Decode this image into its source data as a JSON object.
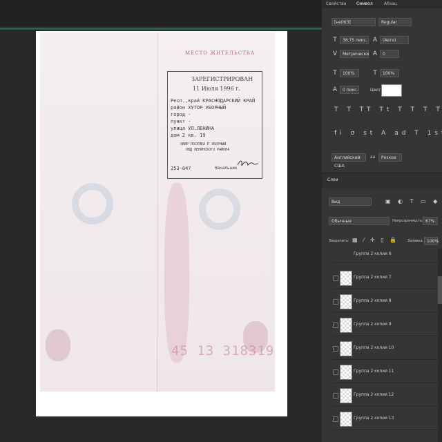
{
  "panel_tabs": [
    "Свойства",
    "Символ",
    "Абзац"
  ],
  "character": {
    "font_family": "[не063]",
    "font_style": "Regular",
    "size": "38,75 пикс.",
    "leading": "(Авто)",
    "kerning": "Метрически",
    "tracking": "0",
    "vert_scale": "100%",
    "horiz_scale": "100%",
    "baseline": "0 пикс.",
    "color_label": "Цвет:",
    "color_value": "#ffffff",
    "language": "Английский: США",
    "antialias": "Резкое",
    "aa_label": "аа"
  },
  "layers": {
    "tab_label": "Слои",
    "filter_kind": "Вид",
    "blend_mode": "Обычные",
    "opacity_label": "Непрозрачность:",
    "opacity_value": "67%",
    "lock_label": "Закрепить:",
    "fill_label": "Заливка:",
    "fill_value": "100%",
    "items": [
      "Группа 2 копия 6",
      "Группа 2 копия 7",
      "Группа 2 копия 8",
      "Группа 2 копия 9",
      "Группа 2 копия 10",
      "Группа 2 копия 11",
      "Группа 2 копия 12",
      "Группа 2 копия 13"
    ]
  },
  "document": {
    "header": "МЕСТО ЖИТЕЛЬСТВА",
    "stamp_lines": [
      "ЗАРЕГИСТРИРОВАН",
      "11 Июля 1996 г.",
      "Респ.,край КРАСНОДАРСКИЙ КРАЙ",
      "район ХУТОР УБОРНЫЙ",
      "город -",
      "пункт -",
      "улица УЛ.ЛЕНИНА",
      "дом 2 кв. 19",
      "ОВИР ПОСЕЛКА П УБОРНЫЙ",
      "ОВД ЛЕНИНСКОГО РАЙОНА",
      "253-047",
      "Начальник"
    ],
    "serial": "45 13 318319"
  }
}
